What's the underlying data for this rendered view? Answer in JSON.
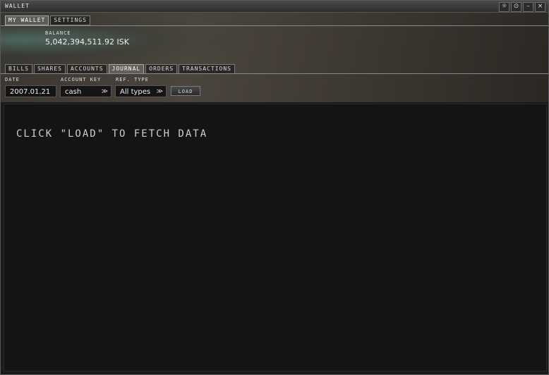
{
  "window": {
    "title": "WALLET",
    "buttons": {
      "pin": "☼",
      "info": "⊙",
      "minimize": "–",
      "close": "×"
    }
  },
  "top_tabs": [
    {
      "label": "MY WALLET",
      "active": true
    },
    {
      "label": "SETTINGS",
      "active": false
    }
  ],
  "balance": {
    "label": "BALANCE",
    "value": "5,042,394,511.92 ISK"
  },
  "sub_tabs": [
    {
      "label": "BILLS",
      "active": false
    },
    {
      "label": "SHARES",
      "active": false
    },
    {
      "label": "ACCOUNTS",
      "active": false
    },
    {
      "label": "JOURNAL",
      "active": true
    },
    {
      "label": "ORDERS",
      "active": false
    },
    {
      "label": "TRANSACTIONS",
      "active": false
    }
  ],
  "filters": {
    "date_label": "DATE",
    "date_value": "2007.01.21",
    "account_key_label": "ACCOUNT KEY",
    "account_key_value": "cash",
    "ref_type_label": "REF. TYPE",
    "ref_type_value": "All types",
    "load_label": "LOAD"
  },
  "content": {
    "message": "CLICK \"LOAD\" TO FETCH DATA"
  }
}
